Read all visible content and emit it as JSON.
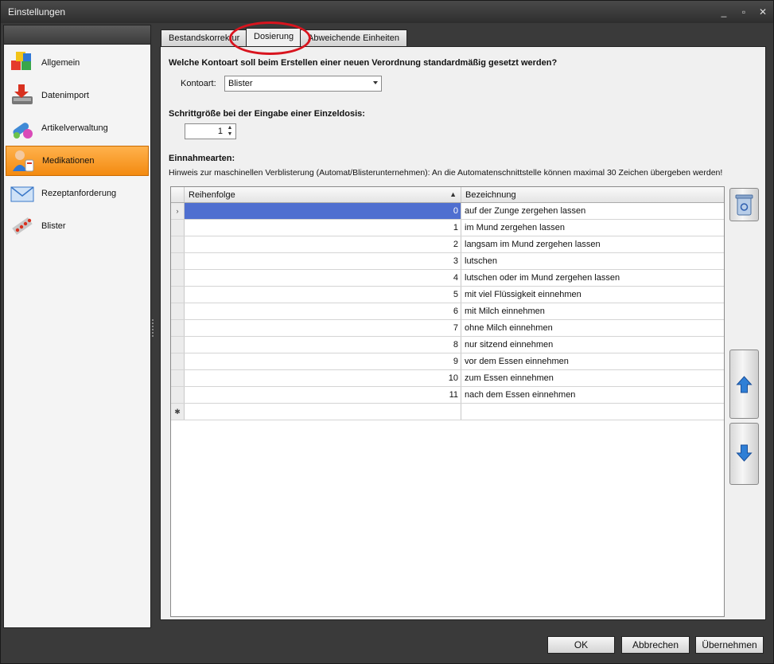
{
  "window": {
    "title": "Einstellungen",
    "controls": [
      "_",
      "▫",
      "✕"
    ]
  },
  "sidebar": {
    "items": [
      {
        "label": "Allgemein",
        "icon": "cubes-icon"
      },
      {
        "label": "Datenimport",
        "icon": "import-icon"
      },
      {
        "label": "Artikelverwaltung",
        "icon": "pills-icon"
      },
      {
        "label": "Medikationen",
        "icon": "medication-icon",
        "active": true
      },
      {
        "label": "Rezeptanforderung",
        "icon": "envelope-icon"
      },
      {
        "label": "Blister",
        "icon": "blister-icon"
      }
    ]
  },
  "tabs": [
    {
      "label": "Bestandskorrektur"
    },
    {
      "label": "Dosierung",
      "active": true
    },
    {
      "label": "Abweichende Einheiten"
    }
  ],
  "dosierung": {
    "question_kontoart": "Welche Kontoart soll beim Erstellen einer neuen Verordnung standardmäßig gesetzt werden?",
    "kontoart_label": "Kontoart:",
    "kontoart_value": "Blister",
    "schrittgroesse_label": "Schrittgröße bei der Eingabe einer Einzeldosis:",
    "schrittgroesse_value": "1",
    "einnahmearten_label": "Einnahmearten:",
    "hinweis": "Hinweis zur maschinellen Verblisterung (Automat/Blisterunternehmen): An die Automatenschnittstelle können maximal 30 Zeichen übergeben werden!"
  },
  "grid": {
    "columns": [
      "Reihenfolge",
      "Bezeichnung"
    ],
    "sort_indicator": "▲",
    "rows": [
      {
        "reihenfolge": "0",
        "bezeichnung": "auf der Zunge zergehen lassen"
      },
      {
        "reihenfolge": "1",
        "bezeichnung": "im Mund zergehen lassen"
      },
      {
        "reihenfolge": "2",
        "bezeichnung": "langsam im Mund zergehen lassen"
      },
      {
        "reihenfolge": "3",
        "bezeichnung": "lutschen"
      },
      {
        "reihenfolge": "4",
        "bezeichnung": "lutschen oder im Mund zergehen lassen"
      },
      {
        "reihenfolge": "5",
        "bezeichnung": "mit viel Flüssigkeit einnehmen"
      },
      {
        "reihenfolge": "6",
        "bezeichnung": "mit Milch einnehmen"
      },
      {
        "reihenfolge": "7",
        "bezeichnung": "ohne Milch einnehmen"
      },
      {
        "reihenfolge": "8",
        "bezeichnung": "nur sitzend einnehmen"
      },
      {
        "reihenfolge": "9",
        "bezeichnung": "vor dem Essen einnehmen"
      },
      {
        "reihenfolge": "10",
        "bezeichnung": "zum Essen einnehmen"
      },
      {
        "reihenfolge": "11",
        "bezeichnung": "nach dem Essen einnehmen"
      }
    ],
    "current_row_marker": "›",
    "new_row_marker": "✱"
  },
  "buttons": {
    "ok": "OK",
    "cancel": "Abbrechen",
    "apply": "Übernehmen"
  },
  "colors": {
    "accent": "#f38a10",
    "selection": "#4f6fd0",
    "highlight_circle": "#d8141e"
  }
}
